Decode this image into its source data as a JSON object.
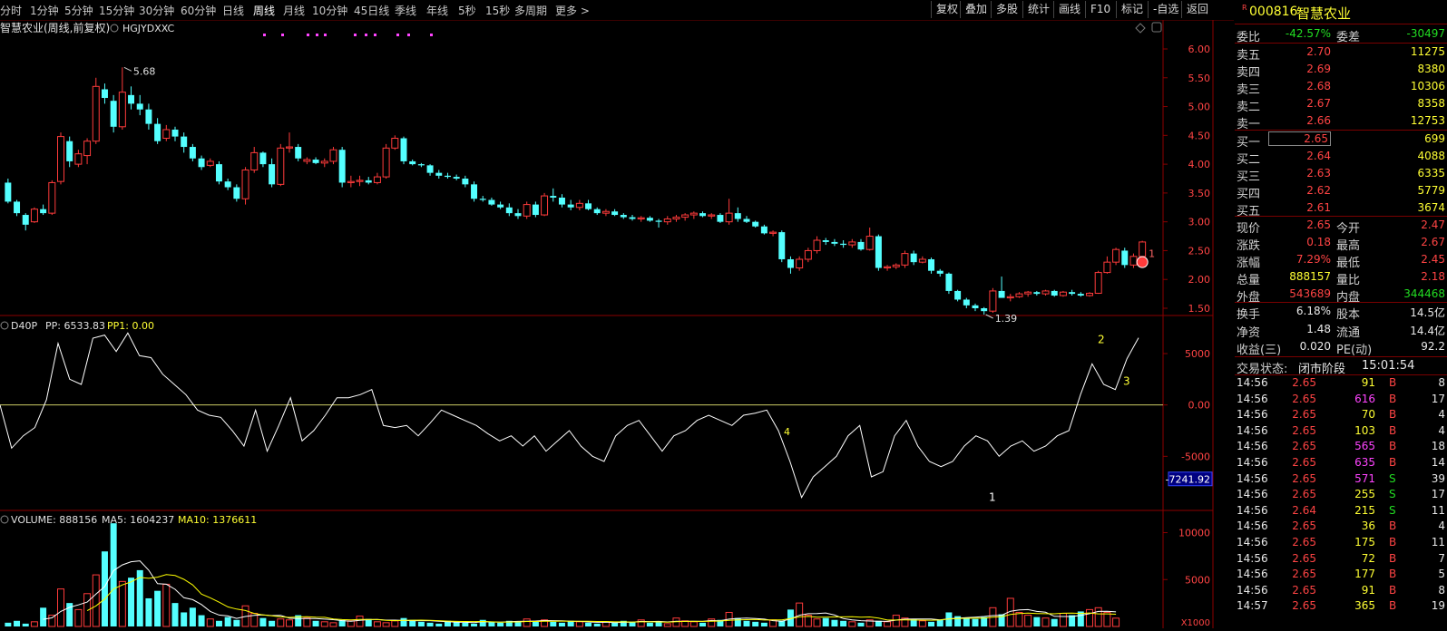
{
  "toolbar": {
    "timeframes": [
      "分时",
      "1分钟",
      "5分钟",
      "15分钟",
      "30分钟",
      "60分钟",
      "日线",
      "周线",
      "月线",
      "10分钟",
      "45日线",
      "季线",
      "年线",
      "5秒",
      "15秒",
      "多周期",
      "更多 >"
    ],
    "active_timeframe": "周线",
    "tools": [
      "复权",
      "叠加",
      "多股",
      "统计",
      "画线",
      "F10",
      "标记",
      "-自选",
      "返回"
    ]
  },
  "chart": {
    "title": "智慧农业(周线,前复权)",
    "indicator_code": "HGJYDXXC",
    "price_ticks": [
      "6.00",
      "5.50",
      "5.00",
      "4.50",
      "4.00",
      "3.50",
      "3.00",
      "2.50",
      "2.00",
      "1.50"
    ],
    "high_label": "5.68",
    "low_label": "1.39",
    "last_marker": "1",
    "d40p_header": {
      "name": "D40P",
      "pp": "PP: 6533.83",
      "pp1": "PP1: 0.00"
    },
    "d40p_ticks": [
      "5000",
      "0.00",
      "-5000"
    ],
    "d40p_cursor_value": "-7241.92",
    "d40p_marks": [
      "1",
      "2",
      "3",
      "4"
    ],
    "volume_header": {
      "name": "VOLUME: 888156",
      "ma5": "MA5: 1604237",
      "ma10": "MA10: 1376611"
    },
    "volume_ticks": [
      "10000",
      "5000"
    ],
    "volume_unit": "X1000",
    "colors": {
      "up": "#ff3b3b",
      "down": "#54ffff",
      "ma5": "#ffffff",
      "ma10": "#ffff00",
      "d40p": "#ffffff",
      "axis": "#8b0000"
    }
  },
  "candles": [
    [
      3.68,
      3.75,
      3.32,
      3.35
    ],
    [
      3.35,
      3.38,
      3.1,
      3.15
    ],
    [
      3.12,
      3.15,
      2.85,
      2.95
    ],
    [
      3.0,
      3.25,
      2.98,
      3.22
    ],
    [
      3.22,
      3.3,
      3.12,
      3.15
    ],
    [
      3.15,
      3.72,
      3.12,
      3.68
    ],
    [
      3.7,
      4.55,
      3.65,
      4.48
    ],
    [
      4.4,
      4.48,
      3.95,
      4.05
    ],
    [
      4.0,
      4.25,
      3.95,
      4.18
    ],
    [
      4.15,
      4.45,
      4.0,
      4.4
    ],
    [
      4.4,
      5.5,
      4.35,
      5.35
    ],
    [
      5.3,
      5.4,
      5.05,
      5.15
    ],
    [
      5.1,
      5.2,
      4.55,
      4.65
    ],
    [
      4.65,
      5.68,
      4.6,
      5.25
    ],
    [
      5.2,
      5.35,
      4.95,
      5.05
    ],
    [
      5.05,
      5.2,
      4.85,
      4.95
    ],
    [
      4.95,
      5.05,
      4.6,
      4.7
    ],
    [
      4.7,
      4.8,
      4.35,
      4.4
    ],
    [
      4.45,
      4.68,
      4.4,
      4.6
    ],
    [
      4.6,
      4.65,
      4.4,
      4.48
    ],
    [
      4.48,
      4.55,
      4.2,
      4.3
    ],
    [
      4.3,
      4.35,
      4.05,
      4.1
    ],
    [
      4.1,
      4.15,
      3.9,
      3.95
    ],
    [
      3.98,
      4.1,
      3.95,
      4.05
    ],
    [
      4.0,
      4.05,
      3.65,
      3.7
    ],
    [
      3.7,
      3.75,
      3.55,
      3.6
    ],
    [
      3.6,
      3.65,
      3.35,
      3.4
    ],
    [
      3.4,
      3.95,
      3.3,
      3.9
    ],
    [
      3.9,
      4.3,
      3.85,
      4.2
    ],
    [
      4.2,
      4.22,
      3.95,
      4.0
    ],
    [
      4.0,
      4.1,
      3.6,
      3.65
    ],
    [
      3.65,
      4.35,
      3.62,
      4.28
    ],
    [
      4.28,
      4.55,
      4.2,
      4.3
    ],
    [
      4.3,
      4.35,
      4.05,
      4.1
    ],
    [
      4.05,
      4.12,
      4.0,
      4.08
    ],
    [
      4.08,
      4.12,
      4.0,
      4.02
    ],
    [
      4.02,
      4.1,
      3.95,
      4.05
    ],
    [
      4.05,
      4.3,
      4.0,
      4.25
    ],
    [
      4.25,
      4.3,
      3.6,
      3.68
    ],
    [
      3.68,
      3.8,
      3.6,
      3.7
    ],
    [
      3.7,
      3.8,
      3.62,
      3.72
    ],
    [
      3.72,
      3.78,
      3.65,
      3.68
    ],
    [
      3.68,
      3.85,
      3.65,
      3.78
    ],
    [
      3.78,
      4.35,
      3.75,
      4.28
    ],
    [
      4.28,
      4.5,
      4.25,
      4.45
    ],
    [
      4.45,
      4.48,
      4.0,
      4.05
    ],
    [
      4.05,
      4.08,
      3.98,
      4.0
    ],
    [
      4.0,
      4.02,
      3.95,
      3.98
    ],
    [
      3.98,
      4.0,
      3.8,
      3.85
    ],
    [
      3.85,
      3.9,
      3.75,
      3.8
    ],
    [
      3.8,
      3.85,
      3.75,
      3.78
    ],
    [
      3.78,
      3.82,
      3.72,
      3.75
    ],
    [
      3.75,
      3.8,
      3.6,
      3.65
    ],
    [
      3.65,
      3.7,
      3.35,
      3.4
    ],
    [
      3.4,
      3.45,
      3.35,
      3.38
    ],
    [
      3.38,
      3.42,
      3.28,
      3.3
    ],
    [
      3.3,
      3.35,
      3.22,
      3.25
    ],
    [
      3.25,
      3.32,
      3.1,
      3.15
    ],
    [
      3.15,
      3.22,
      3.05,
      3.1
    ],
    [
      3.1,
      3.35,
      3.05,
      3.3
    ],
    [
      3.3,
      3.35,
      3.08,
      3.12
    ],
    [
      3.12,
      3.5,
      3.1,
      3.45
    ],
    [
      3.45,
      3.58,
      3.35,
      3.42
    ],
    [
      3.42,
      3.48,
      3.25,
      3.3
    ],
    [
      3.3,
      3.38,
      3.2,
      3.25
    ],
    [
      3.25,
      3.38,
      3.2,
      3.32
    ],
    [
      3.32,
      3.38,
      3.2,
      3.22
    ],
    [
      3.22,
      3.25,
      3.12,
      3.15
    ],
    [
      3.15,
      3.22,
      3.1,
      3.18
    ],
    [
      3.18,
      3.22,
      3.1,
      3.12
    ],
    [
      3.12,
      3.15,
      3.05,
      3.08
    ],
    [
      3.08,
      3.12,
      3.02,
      3.05
    ],
    [
      3.05,
      3.1,
      3.0,
      3.07
    ],
    [
      3.07,
      3.1,
      3.0,
      3.02
    ],
    [
      3.02,
      3.05,
      2.9,
      3.0
    ],
    [
      3.0,
      3.1,
      2.95,
      3.05
    ],
    [
      3.05,
      3.12,
      3.0,
      3.08
    ],
    [
      3.08,
      3.15,
      3.02,
      3.12
    ],
    [
      3.12,
      3.18,
      3.05,
      3.15
    ],
    [
      3.15,
      3.18,
      3.08,
      3.1
    ],
    [
      3.1,
      3.15,
      3.05,
      3.12
    ],
    [
      3.12,
      3.15,
      2.98,
      3.0
    ],
    [
      3.0,
      3.4,
      2.95,
      3.15
    ],
    [
      3.15,
      3.25,
      3.0,
      3.05
    ],
    [
      3.05,
      3.1,
      2.98,
      3.0
    ],
    [
      3.0,
      3.02,
      2.9,
      2.92
    ],
    [
      2.92,
      2.95,
      2.78,
      2.8
    ],
    [
      2.8,
      2.85,
      2.75,
      2.82
    ],
    [
      2.82,
      2.85,
      2.3,
      2.35
    ],
    [
      2.35,
      2.4,
      2.1,
      2.2
    ],
    [
      2.2,
      2.4,
      2.15,
      2.35
    ],
    [
      2.35,
      2.55,
      2.3,
      2.5
    ],
    [
      2.5,
      2.75,
      2.45,
      2.68
    ],
    [
      2.68,
      2.72,
      2.6,
      2.65
    ],
    [
      2.65,
      2.7,
      2.58,
      2.62
    ],
    [
      2.62,
      2.68,
      2.55,
      2.6
    ],
    [
      2.6,
      2.7,
      2.55,
      2.65
    ],
    [
      2.65,
      2.7,
      2.5,
      2.52
    ],
    [
      2.52,
      2.9,
      2.5,
      2.75
    ],
    [
      2.75,
      2.78,
      2.15,
      2.2
    ],
    [
      2.2,
      2.25,
      2.15,
      2.22
    ],
    [
      2.22,
      2.28,
      2.18,
      2.25
    ],
    [
      2.25,
      2.5,
      2.2,
      2.45
    ],
    [
      2.45,
      2.5,
      2.25,
      2.3
    ],
    [
      2.3,
      2.4,
      2.28,
      2.35
    ],
    [
      2.35,
      2.38,
      2.1,
      2.15
    ],
    [
      2.15,
      2.18,
      2.05,
      2.1
    ],
    [
      2.1,
      2.12,
      1.75,
      1.8
    ],
    [
      1.8,
      1.82,
      1.62,
      1.65
    ],
    [
      1.65,
      1.68,
      1.5,
      1.55
    ],
    [
      1.55,
      1.58,
      1.45,
      1.5
    ],
    [
      1.5,
      1.52,
      1.39,
      1.45
    ],
    [
      1.45,
      1.85,
      1.42,
      1.8
    ],
    [
      1.8,
      2.05,
      1.78,
      1.68
    ],
    [
      1.68,
      1.75,
      1.62,
      1.7
    ],
    [
      1.7,
      1.78,
      1.68,
      1.75
    ],
    [
      1.75,
      1.8,
      1.7,
      1.78
    ],
    [
      1.78,
      1.8,
      1.72,
      1.75
    ],
    [
      1.75,
      1.82,
      1.72,
      1.8
    ],
    [
      1.8,
      1.82,
      1.7,
      1.72
    ],
    [
      1.72,
      1.8,
      1.7,
      1.78
    ],
    [
      1.78,
      1.82,
      1.72,
      1.75
    ],
    [
      1.75,
      1.78,
      1.7,
      1.72
    ],
    [
      1.72,
      1.78,
      1.7,
      1.76
    ],
    [
      1.76,
      2.15,
      1.75,
      2.12
    ],
    [
      2.12,
      2.4,
      2.1,
      2.3
    ],
    [
      2.3,
      2.55,
      2.25,
      2.52
    ],
    [
      2.5,
      2.55,
      2.2,
      2.25
    ],
    [
      2.25,
      2.45,
      2.2,
      2.4
    ],
    [
      2.4,
      2.67,
      2.35,
      2.65
    ]
  ],
  "d40p_values": [
    0,
    -4200,
    -3000,
    -2200,
    500,
    6000,
    2500,
    2000,
    6500,
    6800,
    5200,
    7000,
    4800,
    4600,
    3000,
    2000,
    1000,
    -500,
    -1000,
    -1200,
    -2500,
    -4000,
    -500,
    -4500,
    -2000,
    700,
    -3500,
    -2500,
    -1000,
    700,
    700,
    1000,
    1500,
    -2000,
    -2200,
    -2000,
    -3000,
    -1800,
    -500,
    -1000,
    -1500,
    -2000,
    -2800,
    -3500,
    -3000,
    -4000,
    -3000,
    -4500,
    -3500,
    -2500,
    -4000,
    -5000,
    -5500,
    -3000,
    -2000,
    -1500,
    -3000,
    -4500,
    -3000,
    -2500,
    -1500,
    -1000,
    -1500,
    -2000,
    -1000,
    -800,
    -500,
    -2500,
    -5500,
    -9000,
    -7000,
    -6000,
    -5000,
    -3000,
    -2000,
    -7000,
    -6500,
    -3000,
    -1500,
    -4000,
    -5500,
    -6000,
    -5500,
    -4000,
    -3000,
    -3500,
    -5000,
    -4000,
    -3500,
    -4500,
    -4000,
    -3000,
    -2500,
    1000,
    4000,
    2000,
    1500,
    4500,
    6533
  ],
  "volume_values": [
    400,
    600,
    300,
    500,
    2000,
    1200,
    4000,
    2500,
    1800,
    3500,
    5500,
    8000,
    11000,
    4800,
    5200,
    6000,
    3000,
    3800,
    4500,
    2500,
    1500,
    2000,
    1200,
    800,
    600,
    1000,
    700,
    2200,
    1400,
    900,
    600,
    800,
    700,
    1200,
    900,
    600,
    500,
    400,
    700,
    600,
    1100,
    800,
    500,
    400,
    600,
    900,
    700,
    500,
    400,
    300,
    600,
    500,
    400,
    300,
    700,
    500,
    400,
    600,
    500,
    800,
    600,
    700,
    500,
    400,
    600,
    500,
    400,
    300,
    500,
    400,
    600,
    500,
    700,
    400,
    500,
    300,
    900,
    600,
    500,
    400,
    800,
    700,
    1500,
    900,
    600,
    500,
    400,
    700,
    600,
    1800,
    2500,
    1200,
    800,
    900,
    700,
    600,
    500,
    400,
    700,
    600,
    500,
    1200,
    900,
    800,
    600,
    500,
    700,
    1500,
    1100,
    900,
    800,
    1000,
    2000,
    1300,
    3000,
    1500,
    1200,
    1000,
    900,
    800,
    1400,
    1200,
    1600,
    1800,
    2000,
    1500,
    888
  ],
  "quote": {
    "code": "000816",
    "name": "智慧农业",
    "wei_bi_label": "委比",
    "wei_bi": "-42.57%",
    "wei_cha_label": "委差",
    "wei_cha": "-30497",
    "asks": [
      {
        "label": "卖五",
        "price": "2.70",
        "vol": "11275"
      },
      {
        "label": "卖四",
        "price": "2.69",
        "vol": "8380"
      },
      {
        "label": "卖三",
        "price": "2.68",
        "vol": "10306"
      },
      {
        "label": "卖二",
        "price": "2.67",
        "vol": "8358"
      },
      {
        "label": "卖一",
        "price": "2.66",
        "vol": "12753"
      }
    ],
    "bids": [
      {
        "label": "买一",
        "price": "2.65",
        "vol": "699"
      },
      {
        "label": "买二",
        "price": "2.64",
        "vol": "4088"
      },
      {
        "label": "买三",
        "price": "2.63",
        "vol": "6335"
      },
      {
        "label": "买四",
        "price": "2.62",
        "vol": "5779"
      },
      {
        "label": "买五",
        "price": "2.61",
        "vol": "3674"
      }
    ],
    "stats": [
      {
        "l1": "现价",
        "v1": "2.65",
        "c1": "red",
        "l2": "今开",
        "v2": "2.47",
        "c2": "red"
      },
      {
        "l1": "涨跌",
        "v1": "0.18",
        "c1": "red",
        "l2": "最高",
        "v2": "2.67",
        "c2": "red"
      },
      {
        "l1": "涨幅",
        "v1": "7.29%",
        "c1": "red",
        "l2": "最低",
        "v2": "2.45",
        "c2": "red"
      },
      {
        "l1": "总量",
        "v1": "888157",
        "c1": "yellow",
        "l2": "量比",
        "v2": "2.18",
        "c2": "red"
      },
      {
        "l1": "外盘",
        "v1": "543689",
        "c1": "red",
        "l2": "内盘",
        "v2": "344468",
        "c2": "green"
      }
    ],
    "stats2": [
      {
        "l1": "换手",
        "v1": "6.18%",
        "l2": "股本",
        "v2": "14.5亿"
      },
      {
        "l1": "净资",
        "v1": "1.48",
        "l2": "流通",
        "v2": "14.4亿"
      },
      {
        "l1": "收益(三)",
        "v1": "0.020",
        "l2": "PE(动)",
        "v2": "92.2"
      }
    ],
    "status_label": "交易状态:",
    "status_value": "闭市阶段",
    "status_time": "15:01:54",
    "ticks": [
      [
        "14:56",
        "2.65",
        "91",
        "B",
        "8"
      ],
      [
        "14:56",
        "2.65",
        "616",
        "B",
        "17"
      ],
      [
        "14:56",
        "2.65",
        "70",
        "B",
        "4"
      ],
      [
        "14:56",
        "2.65",
        "103",
        "B",
        "4"
      ],
      [
        "14:56",
        "2.65",
        "565",
        "B",
        "18"
      ],
      [
        "14:56",
        "2.65",
        "635",
        "B",
        "14"
      ],
      [
        "14:56",
        "2.65",
        "571",
        "S",
        "39"
      ],
      [
        "14:56",
        "2.65",
        "255",
        "S",
        "17"
      ],
      [
        "14:56",
        "2.64",
        "215",
        "S",
        "11"
      ],
      [
        "14:56",
        "2.65",
        "36",
        "B",
        "4"
      ],
      [
        "14:56",
        "2.65",
        "175",
        "B",
        "11"
      ],
      [
        "14:56",
        "2.65",
        "72",
        "B",
        "7"
      ],
      [
        "14:56",
        "2.65",
        "177",
        "B",
        "5"
      ],
      [
        "14:56",
        "2.65",
        "91",
        "B",
        "8"
      ],
      [
        "14:57",
        "2.65",
        "365",
        "B",
        "19"
      ]
    ]
  }
}
